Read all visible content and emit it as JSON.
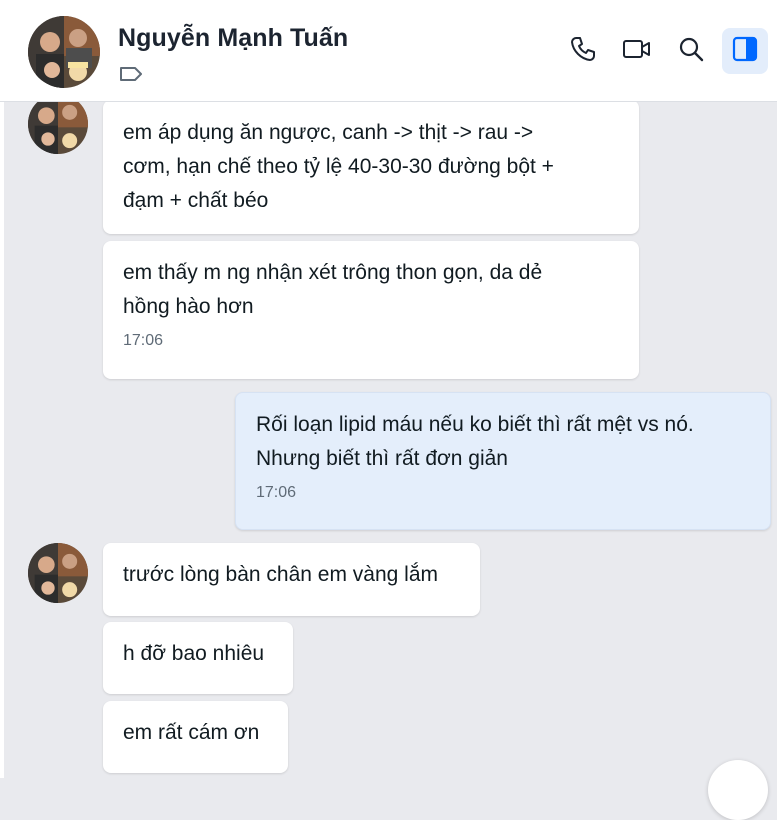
{
  "header": {
    "contact_name": "Nguyễn Mạnh Tuấn",
    "icons": [
      "phone-icon",
      "video-call-icon",
      "search-icon",
      "side-panel-icon",
      "tag-icon"
    ],
    "accent_color": "#0068ff"
  },
  "messages": [
    {
      "sender": "contact",
      "text": "em áp dụng ăn ngược, canh -> thịt -> rau -> \ncơm, hạn chế theo tỷ lệ 40-30-30 đường bột + \nđạm + chất béo"
    },
    {
      "sender": "contact",
      "text": "em thấy m ng nhận xét trông thon gọn, da dẻ \nhồng hào hơn",
      "time": "17:06"
    },
    {
      "sender": "me",
      "text": "Rối loạn lipid máu nếu ko biết thì rất mệt vs nó. \nNhưng biết thì rất đơn giản",
      "time": "17:06"
    },
    {
      "sender": "contact",
      "text": "trước lòng bàn chân em vàng lắm"
    },
    {
      "sender": "contact",
      "text": "h đỡ bao nhiêu"
    },
    {
      "sender": "contact",
      "text": "em rất cám ơn"
    }
  ]
}
